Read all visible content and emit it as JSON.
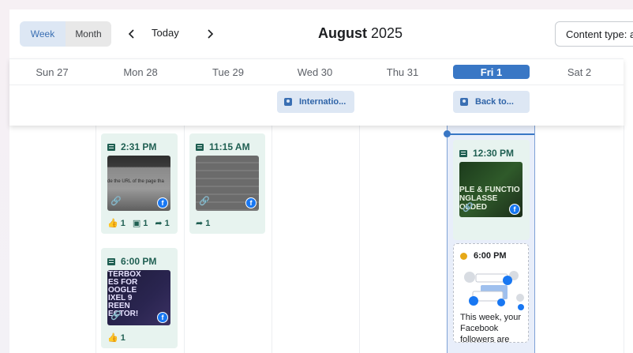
{
  "toolbar": {
    "week_label": "Week",
    "month_label": "Month",
    "prev_icon": "chevron-left-icon",
    "next_icon": "chevron-right-icon",
    "today_label": "Today",
    "title_month": "August",
    "title_year": "2025",
    "content_type_label": "Content type: a"
  },
  "days": [
    {
      "label": "Sun 27",
      "active": false
    },
    {
      "label": "Mon 28",
      "active": false
    },
    {
      "label": "Tue 29",
      "active": false
    },
    {
      "label": "Wed 30",
      "active": false
    },
    {
      "label": "Thu 31",
      "active": false
    },
    {
      "label": "Fri 1",
      "active": true
    },
    {
      "label": "Sat 2",
      "active": false
    }
  ],
  "all_day_events": [
    {
      "label": "Internatio...",
      "day": "Wed 30"
    },
    {
      "label": "Back to...",
      "day": "Fri 1"
    }
  ],
  "posts": [
    {
      "day": "Mon 28",
      "time": "2:31 PM",
      "likes": "1",
      "comments": "1",
      "shares": "1",
      "thumb_text": "de the URL of the page tha"
    },
    {
      "day": "Tue 29",
      "time": "11:15 AM",
      "shares": "1"
    },
    {
      "day": "Mon 28",
      "time": "6:00 PM",
      "likes": "1",
      "thumb_lines": [
        "TERBOX",
        "ES FOR",
        "OOGLE",
        "IXEL 9",
        "REEN",
        "ECTOR!"
      ]
    },
    {
      "day": "Fri 1",
      "time": "12:30 PM",
      "thumb_lines": [
        "PLE & FUNCTIO",
        "NGLASSE",
        "OLDED"
      ]
    }
  ],
  "idea": {
    "time": "6:00 PM",
    "text": "This week, your Facebook followers are"
  },
  "colors": {
    "accent": "#3977c5",
    "post_bg": "#e7f3ef",
    "post_text": "#1f5f52",
    "facebook": "#1877f2"
  }
}
